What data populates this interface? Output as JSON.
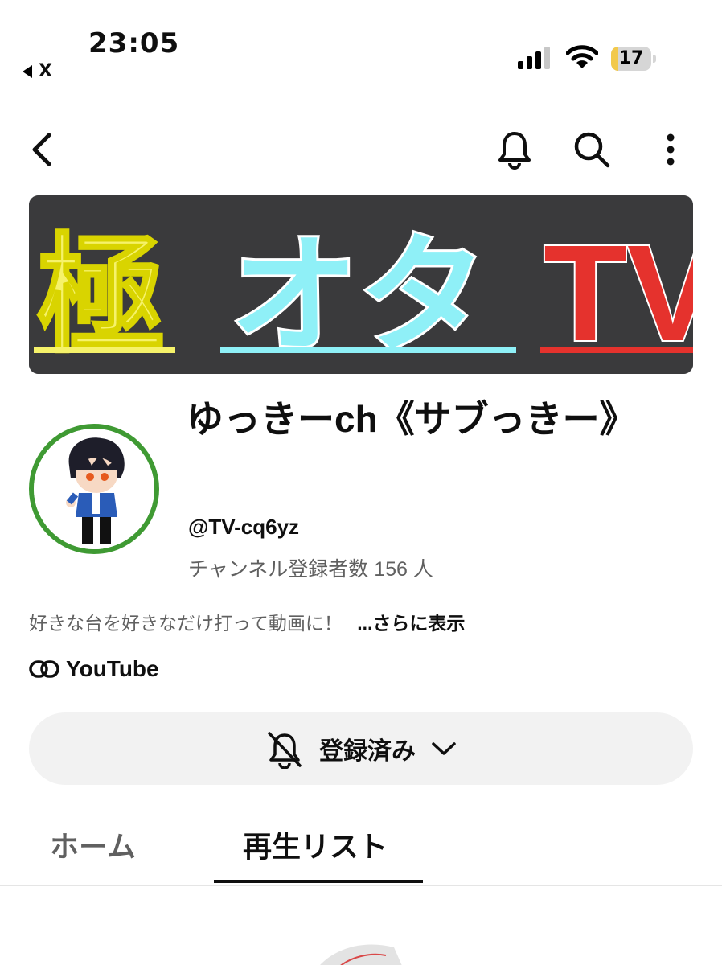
{
  "status_bar": {
    "time": "23:05",
    "back_app": "X",
    "battery_level": 17,
    "battery_text": "17"
  },
  "top_nav": {
    "back_icon": "chevron-left-icon",
    "icons": [
      "bell-icon",
      "search-icon",
      "more-vert-icon"
    ]
  },
  "banner": {
    "part1": "極",
    "part2": "オタ",
    "part3": "TV",
    "colors": {
      "part1": "#f6f26a",
      "part2": "#8ff0f7",
      "part3": "#e5322d",
      "background": "#3a3a3c"
    }
  },
  "channel": {
    "name": "ゆっきーch《サブっきー》",
    "handle": "@TV-cq6yz",
    "subscribers": "チャンネル登録者数 156 人",
    "description": "好きな台を好きなだけ打って動画に！",
    "more_label": "...さらに表示",
    "link_label": "YouTube",
    "avatar_ring_color": "#3f9a33"
  },
  "subscribe_button": {
    "label": "登録済み",
    "icon": "bell-off-icon",
    "dropdown_icon": "chevron-down-icon"
  },
  "tabs": [
    {
      "label": "ホーム",
      "active": false
    },
    {
      "label": "再生リスト",
      "active": true
    }
  ]
}
